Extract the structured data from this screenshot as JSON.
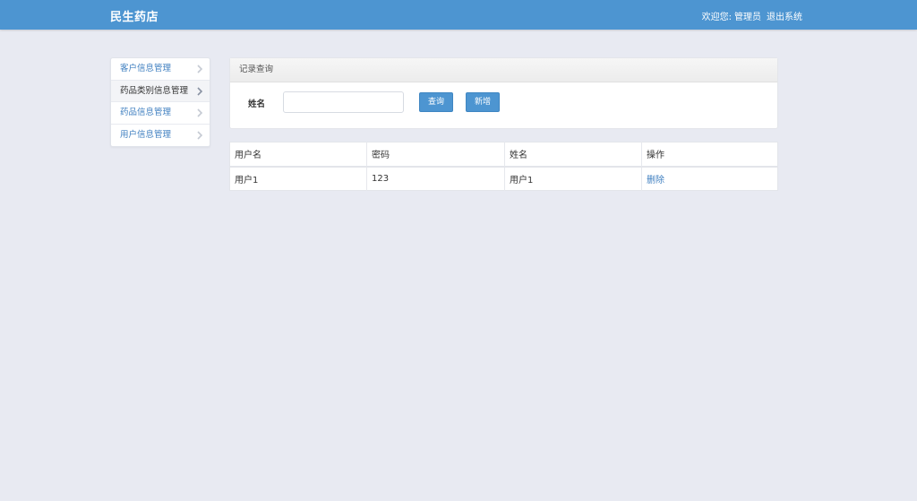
{
  "header": {
    "brand": "民生药店",
    "welcome": "欢迎您:",
    "username": "管理员",
    "logout": "退出系统"
  },
  "sidebar": {
    "items": [
      {
        "label": "客户信息管理"
      },
      {
        "label": "药品类别信息管理"
      },
      {
        "label": "药品信息管理"
      },
      {
        "label": "用户信息管理"
      }
    ]
  },
  "search": {
    "title": "记录查询",
    "name_label": "姓名",
    "name_value": "",
    "query_button": "查询",
    "add_button": "新增"
  },
  "table": {
    "columns": [
      "用户名",
      "密码",
      "姓名",
      "操作"
    ],
    "rows": [
      {
        "username": "用户1",
        "password": "123",
        "name": "用户1",
        "action": "删除"
      }
    ]
  },
  "colors": {
    "primary": "#4d95d1",
    "link": "#3f7fc0",
    "background": "#e8eaf2"
  }
}
